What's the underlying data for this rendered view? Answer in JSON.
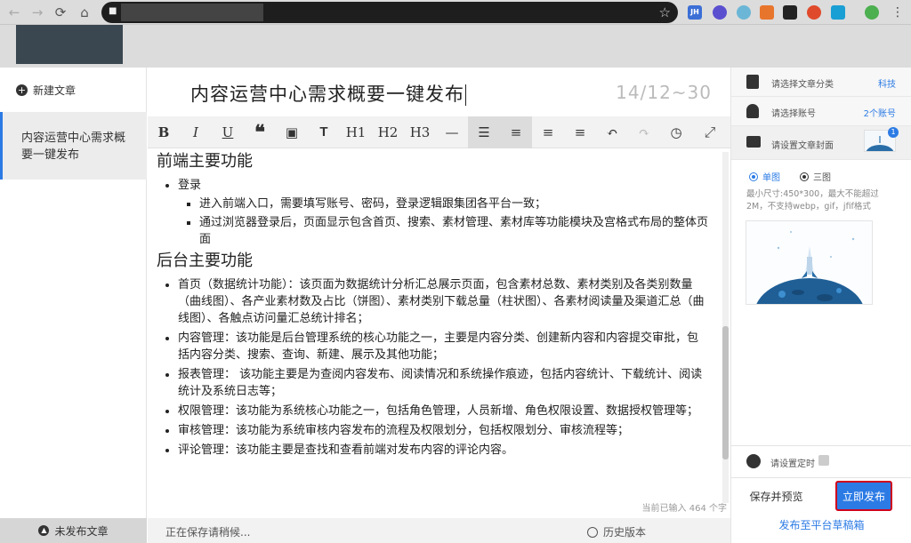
{
  "browser": {
    "back_icon": "←",
    "forward_icon": "→",
    "reload_icon": "⟳",
    "home_icon": "⌂",
    "lock_icon": "🔒",
    "star_icon": "☆",
    "extensions": [
      {
        "name": "JH",
        "color": "#3b6fd6"
      },
      {
        "name": "",
        "color": "#5a4fcf"
      },
      {
        "name": "",
        "color": "#6bb6d6"
      },
      {
        "name": "",
        "color": "#e8752c"
      },
      {
        "name": "",
        "color": "#222222"
      },
      {
        "name": "",
        "color": "#e04a2c"
      },
      {
        "name": "",
        "color": "#1a9fd4"
      },
      {
        "name": "",
        "color": "#4caf50"
      }
    ],
    "menu_icon": "⋮"
  },
  "sidebar": {
    "new_article": "新建文章",
    "draft_title": "内容运营中心需求概要一键发布",
    "unpublished": "未发布文章"
  },
  "editor": {
    "title": "内容运营中心需求概要一键发布",
    "counter": "14/12~30",
    "toolbar": [
      "B",
      "I",
      "U",
      "❝",
      "▣",
      "T",
      "H1",
      "H2",
      "H3",
      "—",
      "☰",
      "≡",
      "≡",
      "≡",
      "↶",
      "↷",
      "◷"
    ],
    "sections": [
      {
        "heading": "前端主要功能",
        "items": [
          {
            "text": "登录",
            "sub": [
              "进入前端入口，需要填写账号、密码，登录逻辑跟集团各平台一致；",
              "通过浏览器登录后，页面显示包含首页、搜索、素材管理、素材库等功能模块及宫格式布局的整体页面"
            ]
          }
        ]
      },
      {
        "heading": "后台主要功能",
        "items": [
          {
            "text": "首页（数据统计功能）：该页面为数据统计分析汇总展示页面，包含素材总数、素材类别及各类别数量（曲线图）、各产业素材数及占比（饼图）、素材类别下载总量（柱状图）、各素材阅读量及渠道汇总（曲线图）、各触点访问量汇总统计排名；"
          },
          {
            "text": "内容管理：该功能是后台管理系统的核心功能之一，主要是内容分类、创建新内容和内容提交审批，包括内容分类、搜索、查询、新建、展示及其他功能；"
          },
          {
            "text": "报表管理： 该功能主要是为查阅内容发布、阅读情况和系统操作痕迹，包括内容统计、下载统计、阅读统计及系统日志等；"
          },
          {
            "text": "权限管理：该功能为系统核心功能之一，包括角色管理，人员新增、角色权限设置、数据授权管理等；"
          },
          {
            "text": "审核管理：该功能为系统审核内容发布的流程及权限划分，包括权限划分、审核流程等；"
          },
          {
            "text": "评论管理：该功能主要是查找和查看前端对发布内容的评论内容。"
          }
        ]
      }
    ],
    "word_count": "当前已输入 464 个字"
  },
  "status": {
    "saving": "正在保存请稍候...",
    "history": "历史版本"
  },
  "right": {
    "category_label": "请选择文章分类",
    "category_value": "科技",
    "account_label": "请选择账号",
    "account_value": "2个账号",
    "cover_label": "请设置文章封面",
    "cover_badge": "1",
    "radio_single": "单图",
    "radio_triple": "三图",
    "hint": "最小尺寸:450*300，最大不能超过2M，不支持webp，gif，jfif格式",
    "schedule_label": "请设置定时",
    "preview_btn": "保存并预览",
    "publish_btn": "立即发布",
    "draft_btn": "发布至平台草稿箱"
  }
}
